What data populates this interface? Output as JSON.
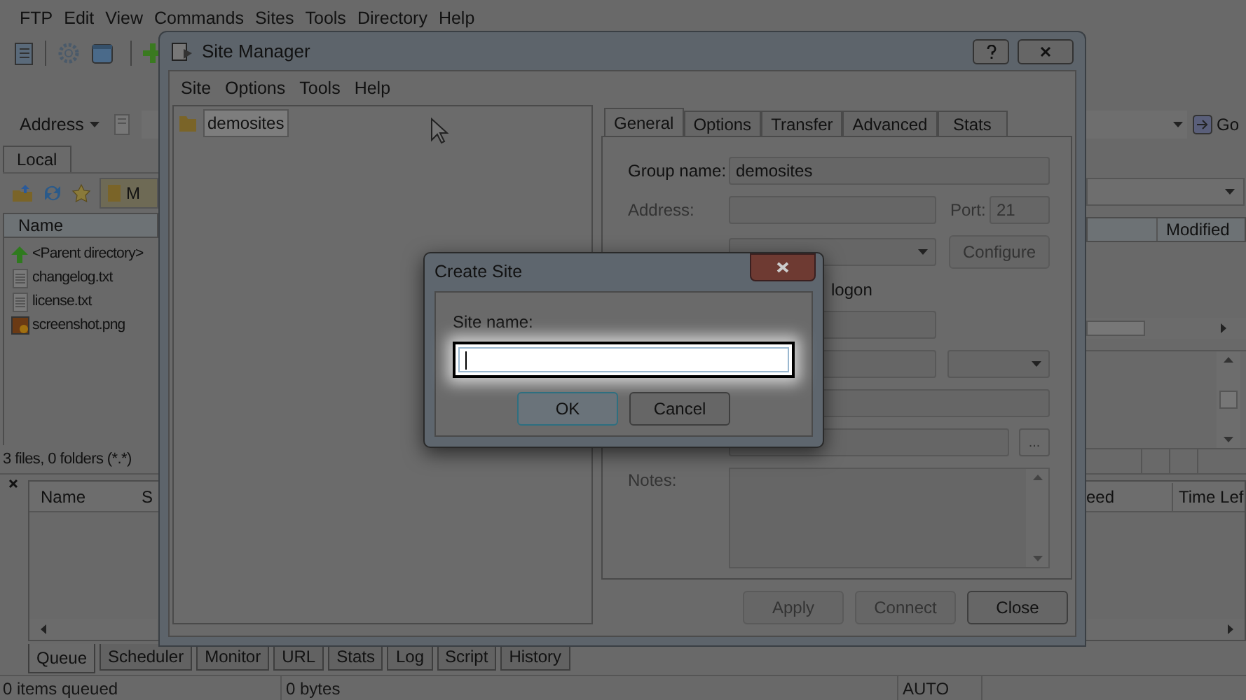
{
  "main_menu": [
    "FTP",
    "Edit",
    "View",
    "Commands",
    "Sites",
    "Tools",
    "Directory",
    "Help"
  ],
  "address_bar": {
    "label": "Address",
    "go_button": "Go"
  },
  "local_pane": {
    "tab": "Local",
    "path": "M",
    "column": "Name",
    "files": [
      {
        "name": "<Parent directory>",
        "kind": "parent"
      },
      {
        "name": "changelog.txt",
        "kind": "text"
      },
      {
        "name": "license.txt",
        "kind": "text"
      },
      {
        "name": "screenshot.png",
        "kind": "image"
      }
    ],
    "status": "3 files, 0 folders (*.*)"
  },
  "remote_pane": {
    "column": "Modified"
  },
  "queue": {
    "left_columns": [
      "Name",
      "S"
    ],
    "right_columns": [
      "eed",
      "Time Lef"
    ],
    "tabs": [
      {
        "label": "Queue",
        "selected": true
      },
      {
        "label": "Scheduler",
        "selected": false
      },
      {
        "label": "Monitor",
        "selected": false
      },
      {
        "label": "URL",
        "selected": false
      },
      {
        "label": "Stats",
        "selected": false
      },
      {
        "label": "Log",
        "selected": false
      },
      {
        "label": "Script",
        "selected": false
      },
      {
        "label": "History",
        "selected": false
      }
    ]
  },
  "status_bar": [
    "0 items queued",
    "0 bytes",
    "AUTO"
  ],
  "site_manager": {
    "title": "Site Manager",
    "menu": [
      "Site",
      "Options",
      "Tools",
      "Help"
    ],
    "tree": [
      {
        "name": "demosites",
        "selected": true
      }
    ],
    "tabs": [
      {
        "label": "General",
        "selected": true
      },
      {
        "label": "Options",
        "selected": false
      },
      {
        "label": "Transfer",
        "selected": false
      },
      {
        "label": "Advanced",
        "selected": false
      },
      {
        "label": "Stats",
        "selected": false
      }
    ],
    "group_name": {
      "label": "Group name:",
      "value": "demosites"
    },
    "address": {
      "label": "Address:",
      "disabled": true
    },
    "port": {
      "label": "Port:",
      "value": "21",
      "disabled": true
    },
    "configure_button": {
      "label": "Configure",
      "disabled": true
    },
    "logon_text": "logon",
    "browse_button": "...",
    "notes_label": "Notes:",
    "buttons": [
      {
        "label": "Apply",
        "disabled": true
      },
      {
        "label": "Connect",
        "disabled": true
      },
      {
        "label": "Close",
        "disabled": false
      }
    ]
  },
  "create_site": {
    "title": "Create Site",
    "field_label": "Site name:",
    "buttons": [
      {
        "label": "OK",
        "default": true
      },
      {
        "label": "Cancel",
        "default": false
      }
    ]
  }
}
